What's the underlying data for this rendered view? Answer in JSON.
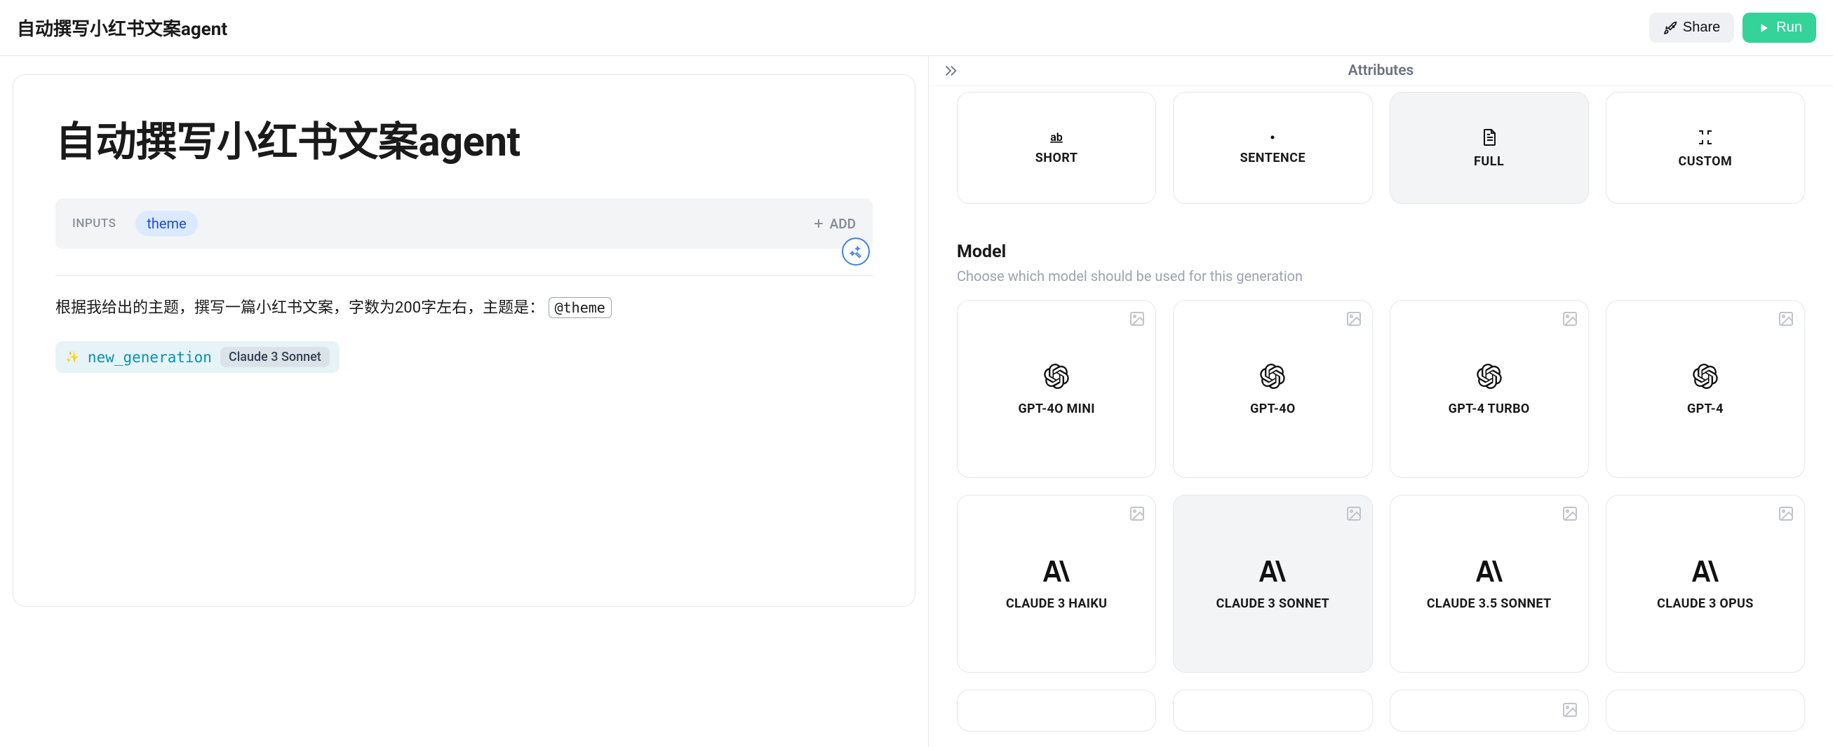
{
  "header": {
    "title": "自动撰写小红书文案agent",
    "share_label": "Share",
    "run_label": "Run"
  },
  "editor": {
    "title": "自动撰写小红书文案agent",
    "inputs_label": "INPUTS",
    "input_chip": "theme",
    "add_label": "ADD",
    "prompt_prefix": "根据我给出的主题，撰写一篇小红书文案，字数为200字左右，主题是：",
    "prompt_mention": "@theme",
    "generation_name": "new_generation",
    "generation_model": "Claude 3 Sonnet"
  },
  "panel": {
    "title": "Attributes",
    "length_options": [
      {
        "label": "SHORT",
        "selected": false,
        "icon": "short"
      },
      {
        "label": "SENTENCE",
        "selected": false,
        "icon": "sentence"
      },
      {
        "label": "FULL",
        "selected": true,
        "icon": "full"
      },
      {
        "label": "CUSTOM",
        "selected": false,
        "icon": "custom"
      }
    ],
    "model_section_title": "Model",
    "model_section_sub": "Choose which model should be used for this generation",
    "models": [
      {
        "label": "GPT-4O MINI",
        "logo": "openai",
        "selected": false
      },
      {
        "label": "GPT-4O",
        "logo": "openai",
        "selected": false
      },
      {
        "label": "GPT-4 TURBO",
        "logo": "openai",
        "selected": false
      },
      {
        "label": "GPT-4",
        "logo": "openai",
        "selected": false
      },
      {
        "label": "CLAUDE 3 HAIKU",
        "logo": "anthropic",
        "selected": false
      },
      {
        "label": "CLAUDE 3 SONNET",
        "logo": "anthropic",
        "selected": true
      },
      {
        "label": "CLAUDE 3.5 SONNET",
        "logo": "anthropic",
        "selected": false
      },
      {
        "label": "CLAUDE 3 OPUS",
        "logo": "anthropic",
        "selected": false
      }
    ]
  }
}
